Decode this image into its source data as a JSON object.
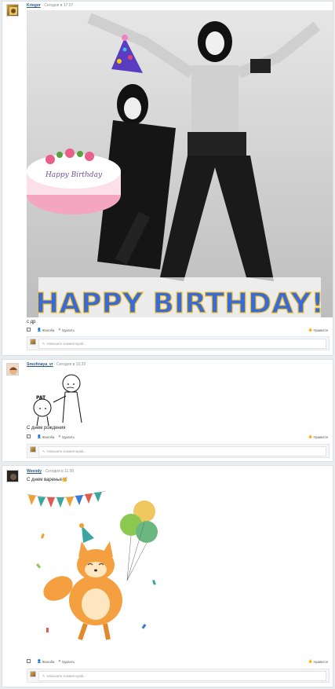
{
  "posts": [
    {
      "author": "Kriegor",
      "time": "· Сегодня в 17:07",
      "text": "с др",
      "image_caption": "HAPPY BIRTHDAY!",
      "cake_text": "Happy Birthday"
    },
    {
      "author": "Snezhnaya_vr",
      "time": "· Сегодня в 10:29",
      "text": "С днем рождения",
      "sketch_label": "PAT"
    },
    {
      "author": "Weendy",
      "time": "· Сегодня в 11:00",
      "text": "С днем варенья🥳"
    }
  ],
  "actions": {
    "like": "Жалоба",
    "delete": "Удалить",
    "reply": "Нравится"
  },
  "comment": {
    "placeholder": "Напишите комментарий..."
  },
  "colors": {
    "link": "#2a5885",
    "border": "#dde1e5",
    "page_bg": "#e9ecef"
  }
}
